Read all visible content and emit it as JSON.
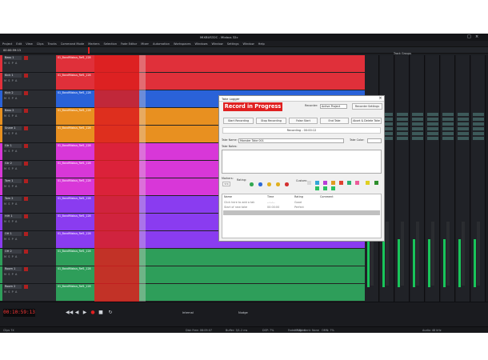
{
  "window": {
    "title": "MIXBUS32C - Mixbus 32c"
  },
  "menu": [
    "Project",
    "Edit",
    "View",
    "Clips",
    "Tracks",
    "Command Mode",
    "Markers",
    "Selection",
    "Fade Editor",
    "Mixer",
    "Automation",
    "Workspaces",
    "Windows",
    "Window",
    "Settings",
    "Window",
    "Help"
  ],
  "ruler": {
    "clock": "00:00:59:13",
    "labels": [
      "Bars",
      "Timecode"
    ]
  },
  "tracks": [
    {
      "name": "Bass 1",
      "color": "#e0303a"
    },
    {
      "name": "Kick 1",
      "color": "#e0303a"
    },
    {
      "name": "Kick 2",
      "color": "#2a62d8"
    },
    {
      "name": "Bass 2",
      "color": "#e89020"
    },
    {
      "name": "Snare 1",
      "color": "#e89020"
    },
    {
      "name": "Gtr 1",
      "color": "#d837d8"
    },
    {
      "name": "Gtr 2",
      "color": "#d837d8"
    },
    {
      "name": "Tom 1",
      "color": "#d837d8"
    },
    {
      "name": "Tom 2",
      "color": "#8a3cf0"
    },
    {
      "name": "HiH 1",
      "color": "#8a3cf0"
    },
    {
      "name": "OH 1",
      "color": "#8a3cf0"
    },
    {
      "name": "OH 2",
      "color": "#2e9e5a"
    },
    {
      "name": "Room 1",
      "color": "#2e9e5a"
    },
    {
      "name": "Room 2",
      "color": "#2e9e5a"
    }
  ],
  "clip_name": "01_BandMixbus_Ref1_128",
  "mixer_title": "Track Groups",
  "dialog": {
    "title": "Take Logger",
    "banner": "Record in Progress",
    "recorder_label": "Recorder:",
    "recorder_value": "Active Project",
    "recorder_settings": "Recorder Settings",
    "buttons": [
      "Start Recording",
      "Stop Recording",
      "False Start",
      "End Take",
      "Abort & Delete Take"
    ],
    "recording_status": "Recording - 00:00:12",
    "take_name_label": "Take Name:",
    "take_name_value": "Monster Take 001",
    "take_color_label": "Take Color:",
    "take_notes_label": "Take Notes:",
    "markers_label": "Markers:",
    "rating_label": "Rating:",
    "custom_label": "Custom:",
    "table_headers": [
      "Name",
      "Time",
      "Rating",
      "Comment"
    ],
    "rows": [
      {
        "name": "Click here to add a tak",
        "time": "--:--:-- ",
        "rating": "Good",
        "comment": ""
      },
      {
        "name": "Start of new take",
        "time": "00:00:00",
        "rating": "Perfect",
        "comment": ""
      },
      {
        "name": "",
        "time": "",
        "rating": "",
        "comment": ""
      }
    ]
  },
  "transport": {
    "timecode": "00:10:59:13",
    "sync": "Internal",
    "mode": "Nudge"
  },
  "status": {
    "items": [
      "Clips 7X",
      "Disk Free: 08:09:07",
      "Buffer: 3/1.2 ms",
      "DSP: 7%",
      "XRUN: 0",
      "OMN: 7%",
      "Audio: 48 kHz",
      "Fader Alignment: None"
    ]
  }
}
